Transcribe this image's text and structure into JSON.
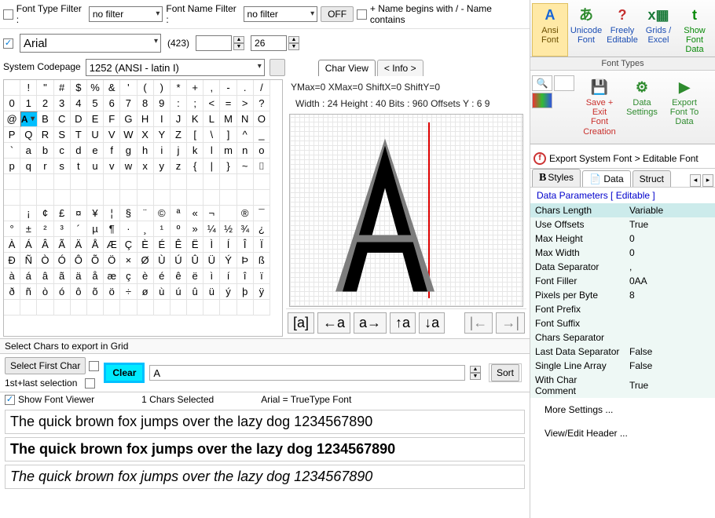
{
  "filter": {
    "type_label": "Font Type Filter :",
    "type_value": "no filter",
    "name_label": "Font Name Filter :",
    "name_value": "no filter",
    "off": "OFF",
    "mode_label": "+ Name begins with / - Name contains"
  },
  "font_row": {
    "font_name": "Arial",
    "count": "(423)",
    "size": "26"
  },
  "codepage": {
    "label": "System Codepage",
    "value": "1252  (ANSI - latin I)"
  },
  "tabs": {
    "charview": "Char View",
    "info": "< Info >"
  },
  "charview": {
    "ymax": "YMax=0  XMax=0  ShiftX=0  ShiftY=0",
    "metrics": "Width : 24 Height : 40  Bits : 960  Offsets Y : 6 9",
    "tools": {
      "aBracket": "[a]",
      "leftA": "←a",
      "aRight": "a→",
      "upA": "↑a",
      "downA": "↓a",
      "stepL": "|←",
      "stepR": "→|"
    }
  },
  "grid_rows": [
    [
      " ",
      "!",
      "\"",
      "#",
      "$",
      "%",
      "&",
      "'",
      "(",
      ")",
      "*",
      "+",
      ",",
      "-",
      ".",
      "/"
    ],
    [
      "0",
      "1",
      "2",
      "3",
      "4",
      "5",
      "6",
      "7",
      "8",
      "9",
      ":",
      ";",
      "<",
      "=",
      ">",
      "?"
    ],
    [
      "@",
      "A",
      "B",
      "C",
      "D",
      "E",
      "F",
      "G",
      "H",
      "I",
      "J",
      "K",
      "L",
      "M",
      "N",
      "O"
    ],
    [
      "P",
      "Q",
      "R",
      "S",
      "T",
      "U",
      "V",
      "W",
      "X",
      "Y",
      "Z",
      "[",
      "\\",
      "]",
      "^",
      "_"
    ],
    [
      "`",
      "a",
      "b",
      "c",
      "d",
      "e",
      "f",
      "g",
      "h",
      "i",
      "j",
      "k",
      "l",
      "m",
      "n",
      "o"
    ],
    [
      "p",
      "q",
      "r",
      "s",
      "t",
      "u",
      "v",
      "w",
      "x",
      "y",
      "z",
      "{",
      "|",
      "}",
      "~",
      "⌷"
    ],
    [
      "",
      "",
      "",
      "",
      "",
      "",
      "",
      "",
      "",
      "",
      "",
      "",
      "",
      "",
      "",
      ""
    ],
    [
      "",
      "",
      "",
      "",
      "",
      "",
      "",
      "",
      "",
      "",
      "",
      "",
      "",
      "",
      "",
      ""
    ],
    [
      " ",
      "¡",
      "¢",
      "£",
      "¤",
      "¥",
      "¦",
      "§",
      "¨",
      "©",
      "ª",
      "«",
      "¬",
      "­",
      "®",
      "¯"
    ],
    [
      "°",
      "±",
      "²",
      "³",
      "´",
      "µ",
      "¶",
      "·",
      "¸",
      "¹",
      "º",
      "»",
      "¼",
      "½",
      "¾",
      "¿"
    ],
    [
      "À",
      "Á",
      "Â",
      "Ã",
      "Ä",
      "Å",
      "Æ",
      "Ç",
      "È",
      "É",
      "Ê",
      "Ë",
      "Ì",
      "Í",
      "Î",
      "Ï"
    ],
    [
      "Ð",
      "Ñ",
      "Ò",
      "Ó",
      "Ô",
      "Õ",
      "Ö",
      "×",
      "Ø",
      "Ù",
      "Ú",
      "Û",
      "Ü",
      "Ý",
      "Þ",
      "ß"
    ],
    [
      "à",
      "á",
      "â",
      "ã",
      "ä",
      "å",
      "æ",
      "ç",
      "è",
      "é",
      "ê",
      "ë",
      "ì",
      "í",
      "î",
      "ï"
    ],
    [
      "ð",
      "ñ",
      "ò",
      "ó",
      "ô",
      "õ",
      "ö",
      "÷",
      "ø",
      "ù",
      "ú",
      "û",
      "ü",
      "ý",
      "þ",
      "ÿ"
    ],
    [
      "",
      "",
      "",
      "",
      "",
      "",
      "",
      "",
      "",
      "",
      "",
      "",
      "",
      "",
      "",
      ""
    ]
  ],
  "selected_cell": {
    "row": 2,
    "col": 1,
    "char": "A"
  },
  "info_bar": "Select Chars to export in Grid",
  "sel_area": {
    "first_btn": "Select First Char",
    "clear": "Clear",
    "last_label": "1st+last selection",
    "char_input": "A",
    "sort": "Sort"
  },
  "status": {
    "show_viewer": "Show Font Viewer",
    "chars_selected": "1 Chars Selected",
    "font_type": "Arial = TrueType Font"
  },
  "pangrams": {
    "normal": "The quick brown fox jumps over the lazy dog 1234567890",
    "bold": "The quick brown fox jumps over the lazy dog 1234567890",
    "italic": "The quick brown fox jumps over the lazy dog 1234567890"
  },
  "ribbon1": {
    "items": [
      {
        "line1": "Ansi",
        "line2": "Font",
        "color": "#1565d8",
        "glyph": "A",
        "active": true
      },
      {
        "line1": "Unicode",
        "line2": "Font",
        "color": "#2e8b2e",
        "glyph": "あ"
      },
      {
        "line1": "Freely",
        "line2": "Editable",
        "color": "#c53030",
        "glyph": "?"
      },
      {
        "line1": "Grids /",
        "line2": "Excel",
        "color": "#1b7a3a",
        "glyph": "x▦"
      },
      {
        "line1": "Show",
        "line2": "Font",
        "line3": "Data",
        "color": "#0a8a0a",
        "glyph": "t"
      }
    ],
    "caption": "Font Types"
  },
  "ribbon2": {
    "items": [
      {
        "line1": "Save + Exit",
        "line2": "Font",
        "line3": "Creation",
        "color": "#c9302c"
      },
      {
        "line1": "Data",
        "line2": "Settings",
        "color": "#2e8b2e"
      },
      {
        "line1": "Export",
        "line2": "Font To",
        "line3": "Data",
        "color": "#2e8b2e"
      }
    ]
  },
  "export_title": "Export System Font > Editable Font",
  "rtabs": {
    "styles": "Styles",
    "data": "Data",
    "struct": "Struct"
  },
  "params": {
    "header": "Data Parameters [ Editable ]",
    "rows": [
      {
        "k": "Chars Length",
        "v": "Variable"
      },
      {
        "k": "Use Offsets",
        "v": "True"
      },
      {
        "k": "Max Height",
        "v": "0"
      },
      {
        "k": "Max Width",
        "v": "0"
      },
      {
        "k": "Data Separator",
        "v": ","
      },
      {
        "k": "Font Filler",
        "v": "0AA"
      },
      {
        "k": "Pixels per Byte",
        "v": "8"
      },
      {
        "k": "Font Prefix",
        "v": ""
      },
      {
        "k": "Font Suffix",
        "v": ""
      },
      {
        "k": "Chars Separator",
        "v": ""
      },
      {
        "k": "Last Data Separator",
        "v": "False"
      },
      {
        "k": "Single Line Array",
        "v": "False"
      },
      {
        "k": "With Char Comment",
        "v": "True"
      }
    ]
  },
  "links": {
    "more": "More Settings ...",
    "header": "View/Edit Header ..."
  }
}
